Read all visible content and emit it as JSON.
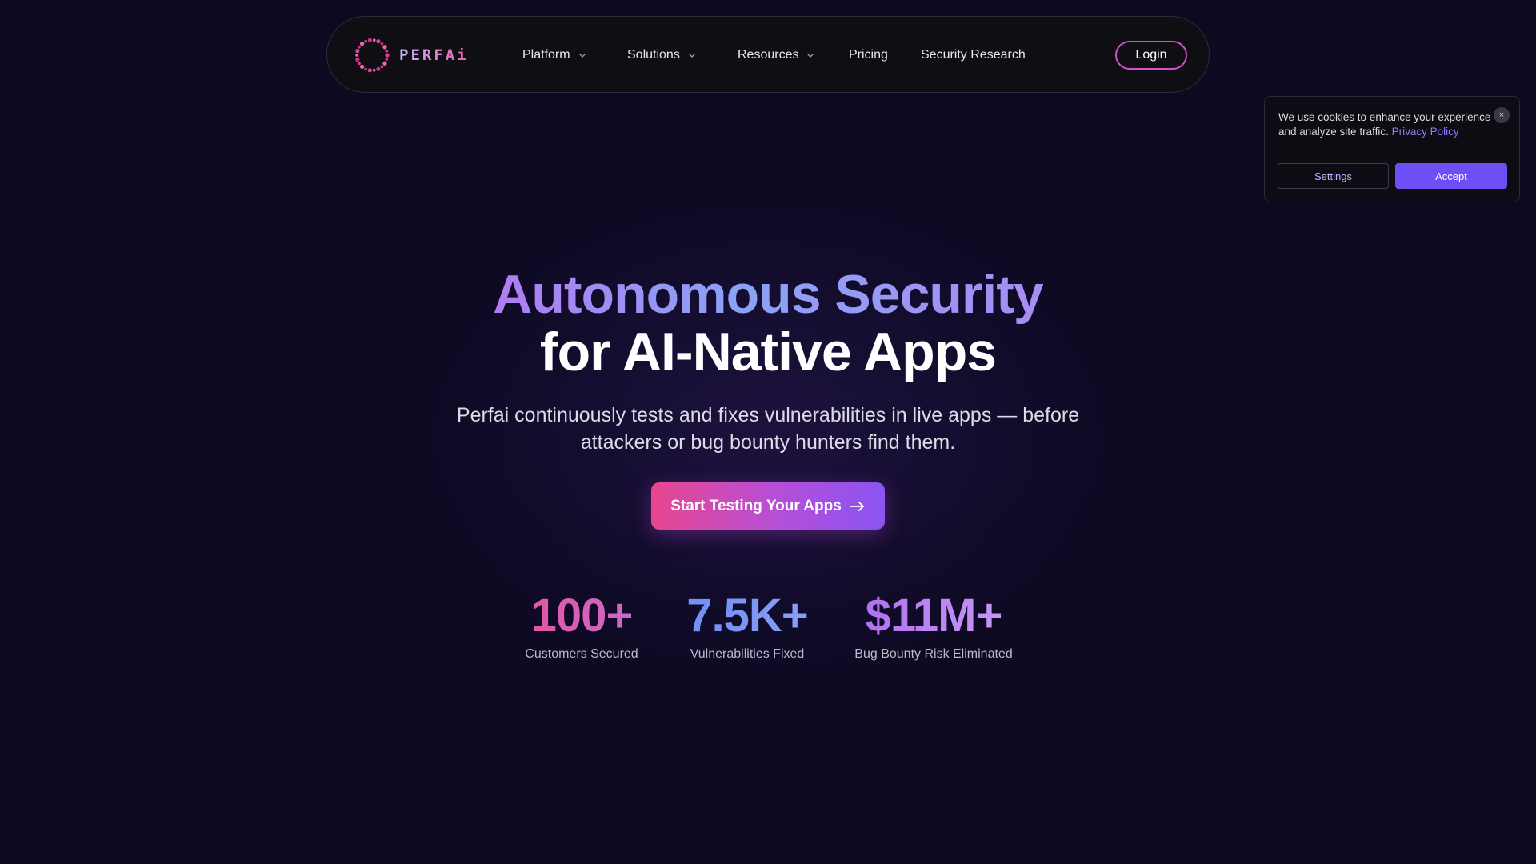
{
  "nav": {
    "logo_text": "PERFAi",
    "items": [
      {
        "label": "Platform",
        "has_dropdown": true
      },
      {
        "label": "Solutions",
        "has_dropdown": true
      },
      {
        "label": "Resources",
        "has_dropdown": true
      },
      {
        "label": "Pricing",
        "has_dropdown": false
      },
      {
        "label": "Security Research",
        "has_dropdown": false
      }
    ],
    "login_label": "Login"
  },
  "cookie": {
    "message": "We use cookies to enhance your experience and analyze site traffic.",
    "policy_link": "Privacy Policy",
    "close_label": "×",
    "settings_label": "Settings",
    "accept_label": "Accept"
  },
  "hero": {
    "title_line1": "Autonomous Security",
    "title_line2": "for AI-Native Apps",
    "subtitle": "Perfai continuously tests and fixes vulnerabilities in live apps — before attackers or bug bounty hunters find them.",
    "cta_label": "Start Testing Your Apps"
  },
  "stats": [
    {
      "value": "100+",
      "label": "Customers Secured"
    },
    {
      "value": "7.5K+",
      "label": "Vulnerabilities Fixed"
    },
    {
      "value": "$11M+",
      "label": "Bug Bounty Risk Eliminated"
    }
  ],
  "colors": {
    "background": "#0d0a20",
    "brand_pink": "#e8468f",
    "brand_purple": "#8a54f2",
    "accept_button": "#6d4ff5",
    "link": "#8b7dff"
  },
  "icons": {
    "logo": "dotted-ring-logo-icon",
    "dropdown": "chevron-down-icon",
    "cta": "arrow-right-icon",
    "cookie_close": "close-icon"
  }
}
